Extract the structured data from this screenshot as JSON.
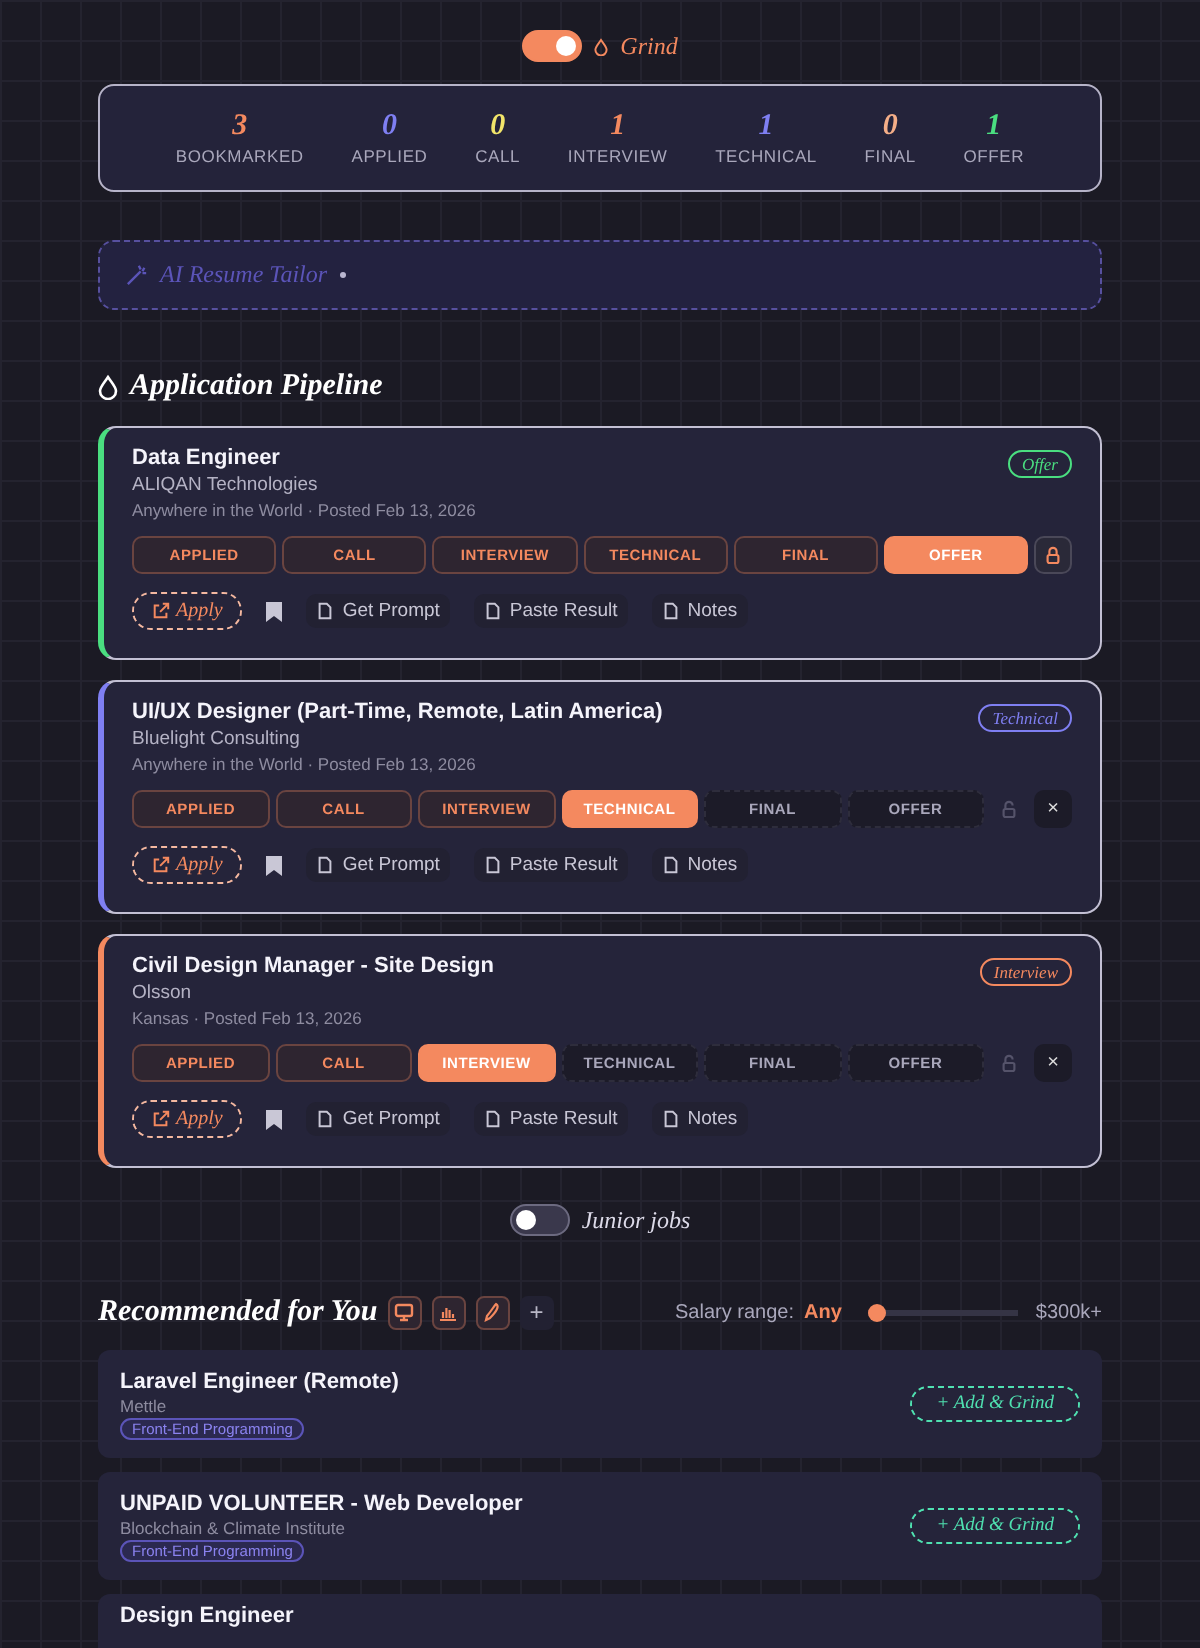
{
  "grind_toggle": {
    "on": true,
    "label": "Grind"
  },
  "stats": [
    {
      "value": "3",
      "label": "BOOKMARKED",
      "color": "#f4895f"
    },
    {
      "value": "0",
      "label": "APPLIED",
      "color": "#7f7ff2"
    },
    {
      "value": "0",
      "label": "CALL",
      "color": "#f2e56a"
    },
    {
      "value": "1",
      "label": "INTERVIEW",
      "color": "#f4895f"
    },
    {
      "value": "1",
      "label": "TECHNICAL",
      "color": "#7f7ff2"
    },
    {
      "value": "0",
      "label": "FINAL",
      "color": "#f4ae88"
    },
    {
      "value": "1",
      "label": "OFFER",
      "color": "#4ade80"
    }
  ],
  "ai_tailor": {
    "label": "AI Resume Tailor"
  },
  "pipeline": {
    "title": "Application Pipeline",
    "jobs": [
      {
        "title": "Data Engineer",
        "company": "ALIQAN Technologies",
        "meta": "Anywhere in the World · Posted Feb 13, 2026",
        "status": "Offer",
        "color": "#4ade80",
        "locked": true,
        "apply": "Apply",
        "tools": [
          "Get Prompt",
          "Paste Result",
          "Notes"
        ],
        "stages": [
          {
            "label": "APPLIED",
            "reached": true,
            "selected": false
          },
          {
            "label": "CALL",
            "reached": true,
            "selected": false
          },
          {
            "label": "INTERVIEW",
            "reached": true,
            "selected": false
          },
          {
            "label": "TECHNICAL",
            "reached": true,
            "selected": false
          },
          {
            "label": "FINAL",
            "reached": true,
            "selected": false
          },
          {
            "label": "OFFER",
            "selected": true
          }
        ]
      },
      {
        "title": "UI/UX Designer (Part-Time, Remote, Latin America)",
        "company": "Bluelight Consulting",
        "meta": "Anywhere in the World · Posted Feb 13, 2026",
        "status": "Technical",
        "color": "#7f7ff2",
        "locked": false,
        "close": "×",
        "apply": "Apply",
        "tools": [
          "Get Prompt",
          "Paste Result",
          "Notes"
        ],
        "stages": [
          {
            "label": "APPLIED",
            "reached": true,
            "selected": false
          },
          {
            "label": "CALL",
            "reached": true,
            "selected": false
          },
          {
            "label": "INTERVIEW",
            "reached": true,
            "selected": false
          },
          {
            "label": "TECHNICAL",
            "selected": true
          },
          {
            "label": "FINAL",
            "reached": false,
            "selected": false
          },
          {
            "label": "OFFER",
            "reached": false,
            "selected": false
          }
        ]
      },
      {
        "title": "Civil Design Manager - Site Design",
        "company": "Olsson",
        "meta": "Kansas · Posted Feb 13, 2026",
        "status": "Interview",
        "color": "#f4895f",
        "locked": false,
        "close": "×",
        "apply": "Apply",
        "tools": [
          "Get Prompt",
          "Paste Result",
          "Notes"
        ],
        "stages": [
          {
            "label": "APPLIED",
            "reached": true,
            "selected": false
          },
          {
            "label": "CALL",
            "reached": true,
            "selected": false
          },
          {
            "label": "INTERVIEW",
            "selected": true
          },
          {
            "label": "TECHNICAL",
            "reached": false,
            "selected": false
          },
          {
            "label": "FINAL",
            "reached": false,
            "selected": false
          },
          {
            "label": "OFFER",
            "reached": false,
            "selected": false
          }
        ]
      }
    ]
  },
  "junior_toggle": {
    "on": false,
    "label": "Junior jobs"
  },
  "recommended": {
    "title": "Recommended for You",
    "filters": [
      {
        "kind": "monitor",
        "selected": true
      },
      {
        "kind": "chart",
        "selected": true
      },
      {
        "kind": "pen",
        "selected": true
      }
    ],
    "add": "+",
    "salary": {
      "label": "Salary range:",
      "value": "Any",
      "level": 0,
      "max": "$300k+"
    },
    "jobs": [
      {
        "title": "Laravel Engineer (Remote)",
        "company": "Mettle",
        "tag": "Front-End Programming",
        "action": "+ Add & Grind"
      },
      {
        "title": "UNPAID VOLUNTEER - Web Developer",
        "company": "Blockchain & Climate Institute",
        "tag": "Front-End Programming",
        "action": "+ Add & Grind"
      },
      {
        "title": "Design Engineer"
      }
    ]
  }
}
